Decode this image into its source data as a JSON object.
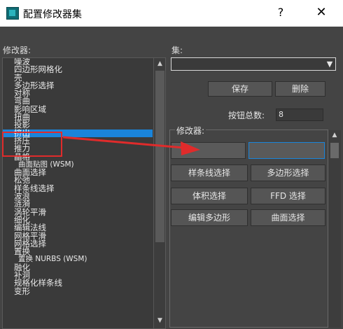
{
  "window": {
    "title": "配置修改器集",
    "help_label": "?",
    "close_label": "✕"
  },
  "left": {
    "label": "修改器:",
    "items": [
      {
        "label": "噪波"
      },
      {
        "label": "四边形网格化"
      },
      {
        "label": "壳"
      },
      {
        "label": "多边形选择"
      },
      {
        "label": "对称"
      },
      {
        "label": "弯曲"
      },
      {
        "label": "影响区域"
      },
      {
        "label": "扭曲"
      },
      {
        "label": "投影"
      },
      {
        "label": "挤出"
      },
      {
        "label": "挤压"
      },
      {
        "label": "推力"
      },
      {
        "label": "晶格"
      },
      {
        "label": "曲面贴图 (WSM)"
      },
      {
        "label": "曲面选择"
      },
      {
        "label": "松弛"
      },
      {
        "label": "样条线选择"
      },
      {
        "label": "波浪"
      },
      {
        "label": "涟漪"
      },
      {
        "label": "涡轮平滑"
      },
      {
        "label": "细化"
      },
      {
        "label": "编辑法线"
      },
      {
        "label": "网格平滑"
      },
      {
        "label": "网格选择"
      },
      {
        "label": "置换"
      },
      {
        "label": "置换 NURBS (WSM)"
      },
      {
        "label": "融化"
      },
      {
        "label": "补洞"
      },
      {
        "label": "规格化样条线"
      },
      {
        "label": "变形"
      }
    ],
    "selected_index": 9
  },
  "right": {
    "set_label": "集:",
    "set_value": "",
    "save_label": "保存",
    "delete_label": "删除",
    "total_label": "按钮总数:",
    "total_value": "8",
    "group_label": "修改器:",
    "slots": [
      "",
      "",
      "样条线选择",
      "多边形选择",
      "体积选择",
      "FFD 选择",
      "编辑多边形",
      "曲面选择"
    ]
  },
  "colors": {
    "selection": "#1a84da",
    "annotation": "#e02b2b"
  }
}
